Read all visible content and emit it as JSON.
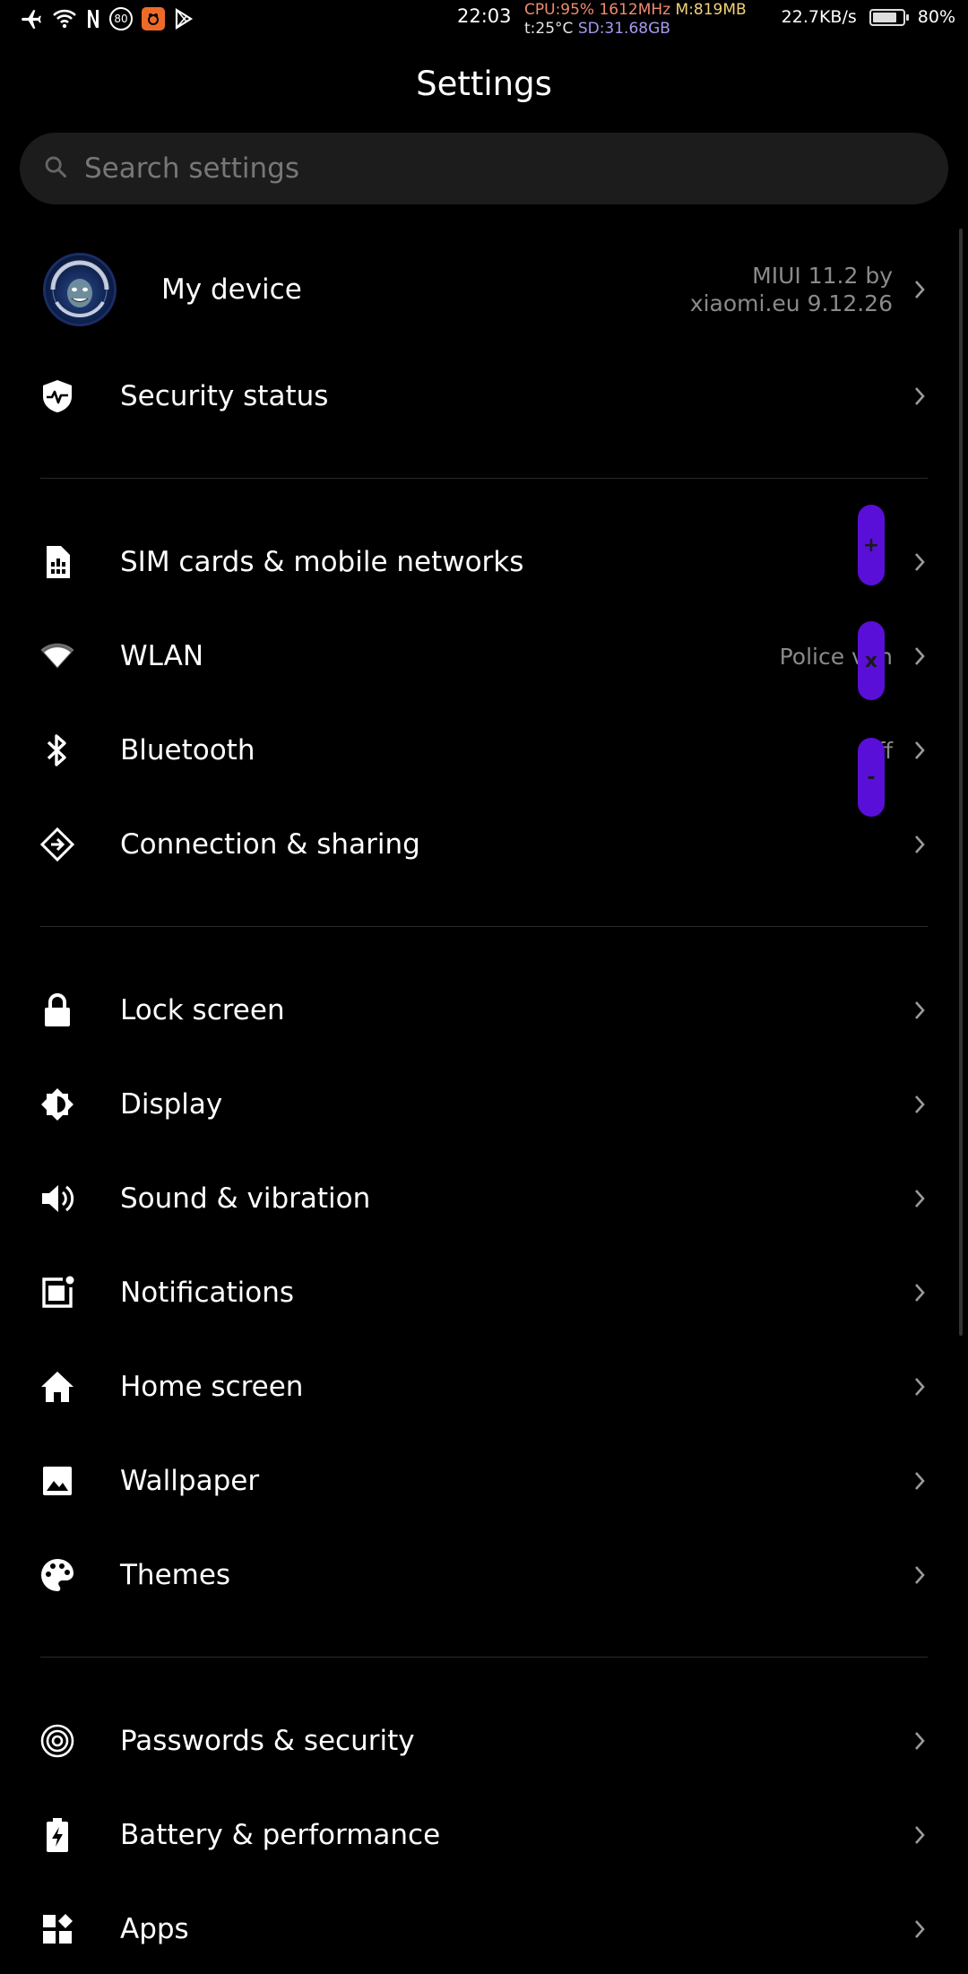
{
  "status_bar": {
    "time": "22:03",
    "badge_number": "80",
    "cpu": "CPU:95%",
    "freq": "1612MHz",
    "mem": "M:819MB",
    "temp": "t:25°C",
    "sd": "SD:31.68GB",
    "net_speed": "22.7KB/s",
    "battery_pct": "80%",
    "battery_level": 0.8,
    "colors": {
      "cpu": "#f08a70",
      "mem": "#f2d27a",
      "sd": "#a59af0"
    }
  },
  "header": {
    "title": "Settings"
  },
  "search": {
    "placeholder": "Search settings",
    "icon": "search-icon"
  },
  "my_device": {
    "label": "My device",
    "value_line1": "MIUI 11.2 by",
    "value_line2": "xiaomi.eu 9.12.26",
    "avatar_icon": "superwitschi-designs-avatar"
  },
  "security": {
    "label": "Security status",
    "icon": "shield-pulse-icon"
  },
  "network": [
    {
      "label": "SIM cards & mobile networks",
      "icon": "sim-card-icon",
      "value": ""
    },
    {
      "label": "WLAN",
      "icon": "wifi-icon",
      "value": "Police van"
    },
    {
      "label": "Bluetooth",
      "icon": "bluetooth-icon",
      "value": "Off"
    },
    {
      "label": "Connection & sharing",
      "icon": "connection-share-icon",
      "value": ""
    }
  ],
  "personal": [
    {
      "label": "Lock screen",
      "icon": "lock-icon"
    },
    {
      "label": "Display",
      "icon": "display-brightness-icon"
    },
    {
      "label": "Sound & vibration",
      "icon": "speaker-icon"
    },
    {
      "label": "Notifications",
      "icon": "notification-icon"
    },
    {
      "label": "Home screen",
      "icon": "home-icon"
    },
    {
      "label": "Wallpaper",
      "icon": "wallpaper-icon"
    },
    {
      "label": "Themes",
      "icon": "palette-icon"
    }
  ],
  "system": [
    {
      "label": "Passwords & security",
      "icon": "fingerprint-icon"
    },
    {
      "label": "Battery & performance",
      "icon": "battery-bolt-icon"
    },
    {
      "label": "Apps",
      "icon": "apps-icon"
    }
  ],
  "overlay_controls": {
    "color": "#5a0fd8",
    "buttons": [
      {
        "label": "+"
      },
      {
        "label": "x"
      },
      {
        "label": "-"
      }
    ]
  }
}
